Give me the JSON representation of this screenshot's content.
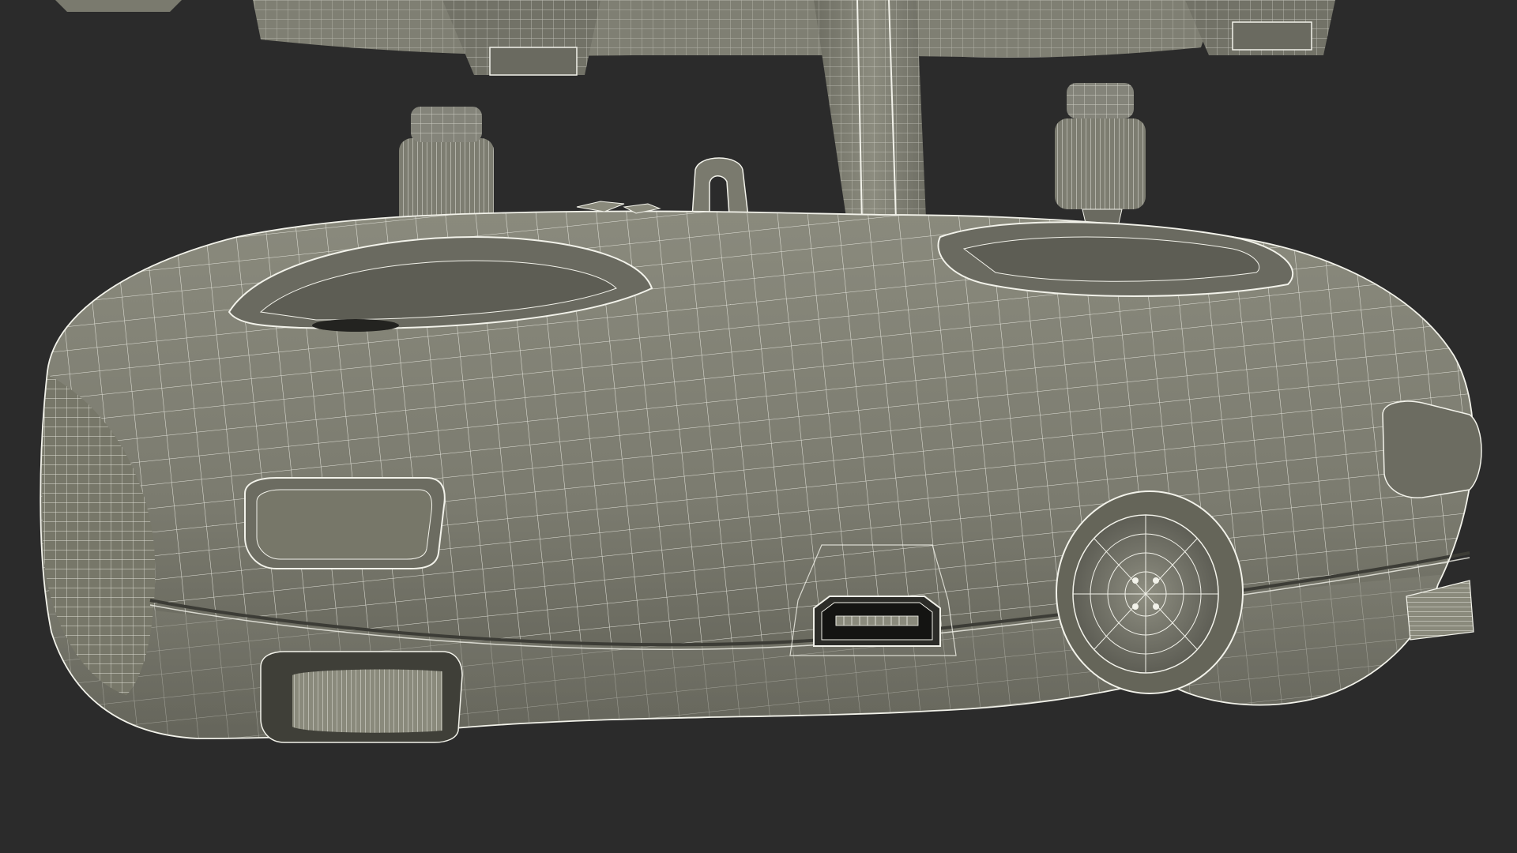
{
  "scene": {
    "subject": "remote-controller-wireframe",
    "background_color": "#2b2b2b",
    "body_color": "#7b7b6f",
    "body_shadow_color": "#5f5f55",
    "highlight_color": "#a3a393",
    "wire_color": "#f2f2ea",
    "port_color": "#1a1a1a",
    "knob_color": "#6e6e62"
  }
}
